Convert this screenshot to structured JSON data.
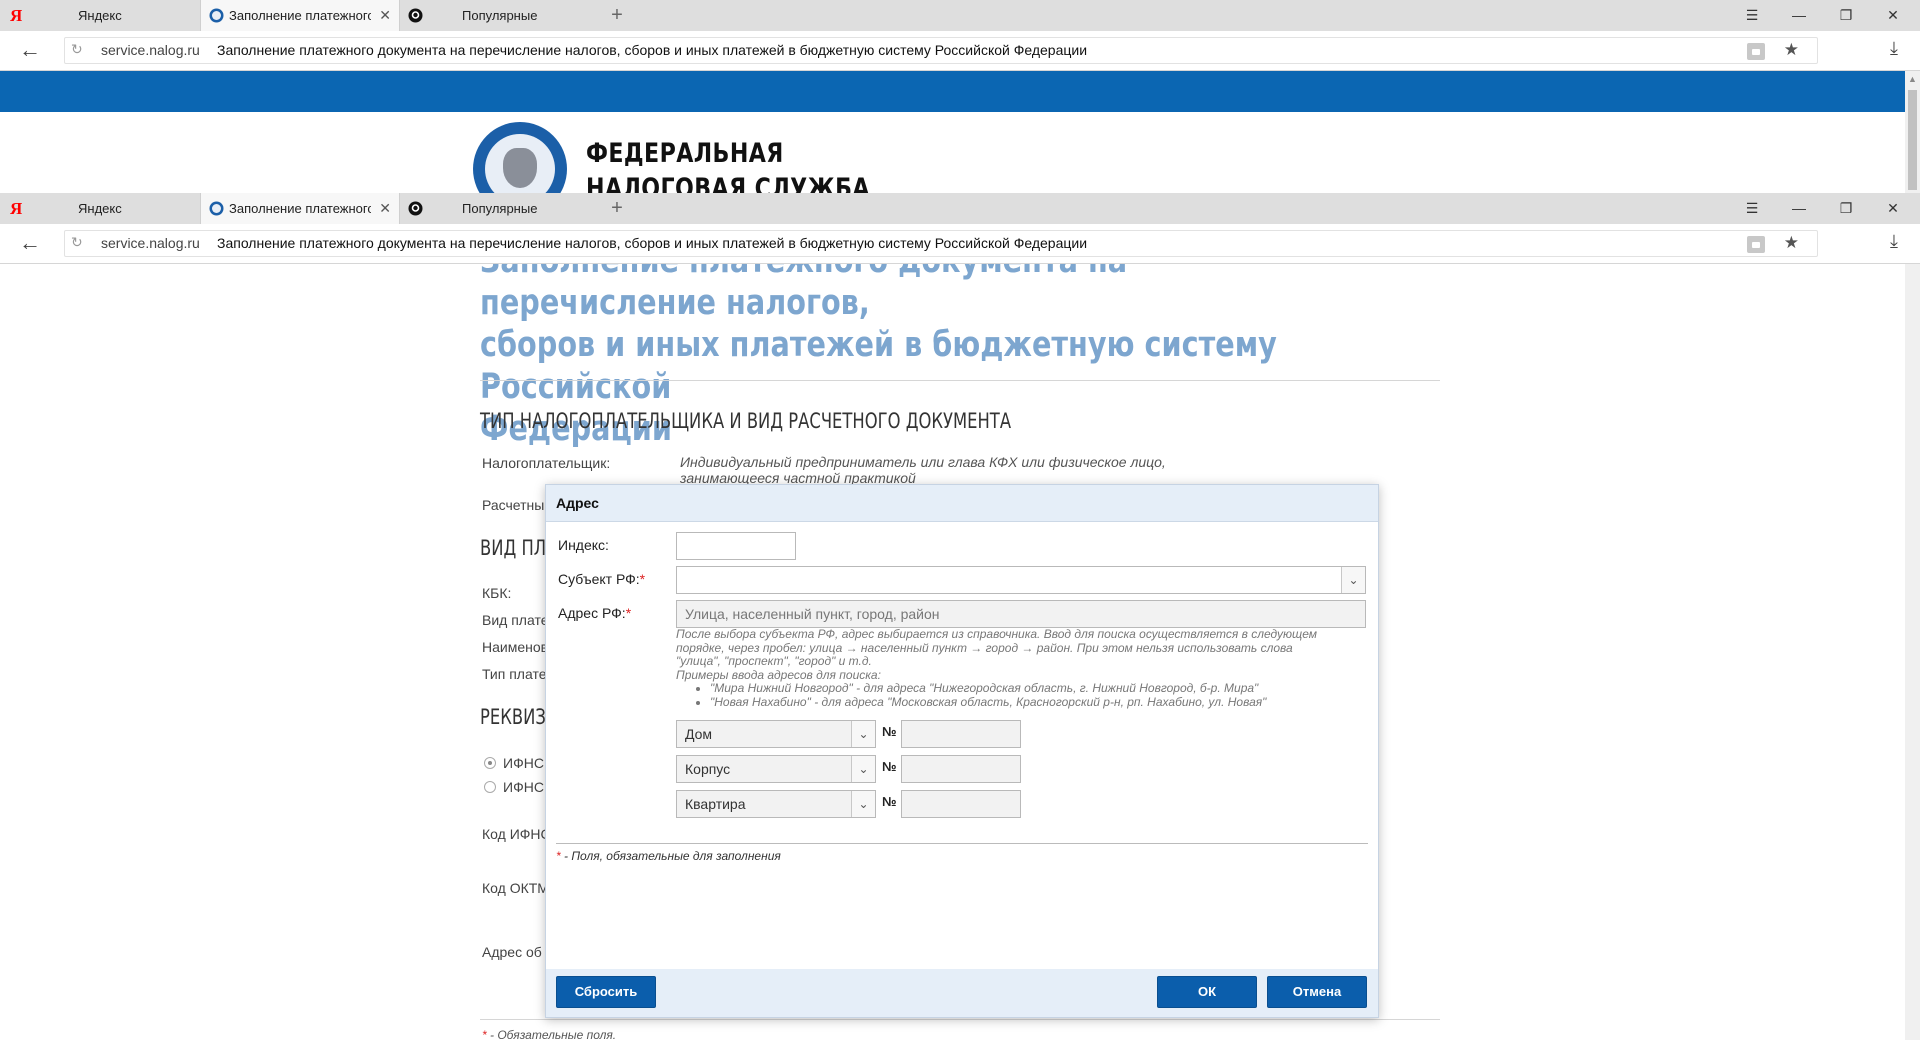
{
  "browser": {
    "tabs": [
      {
        "label": "Яндекс"
      },
      {
        "label": "Заполнение платежного"
      },
      {
        "label": "Популярные"
      }
    ],
    "window_buttons": {
      "menu": "☰",
      "minimize": "—",
      "restore": "❐",
      "close": "✕"
    },
    "newtab_symbol": "+",
    "tab_close_symbol": "✕",
    "yandex_logo": "Я",
    "back_symbol": "←",
    "reload_symbol": "↻",
    "star_symbol": "★",
    "download_symbol": "⤓",
    "domain": "service.nalog.ru",
    "page_title": "Заполнение платежного документа на перечисление налогов, сборов и иных платежей в бюджетную систему Российской Федерации"
  },
  "site": {
    "org_name_line1": "ФЕДЕРАЛЬНАЯ",
    "org_name_line2": "НАЛОГОВАЯ СЛУЖБА",
    "brand_color": "#0b66b2"
  },
  "page": {
    "title_line1": "Заполнение платежного документа на перечисление налогов,",
    "title_line2": "сборов и иных платежей в бюджетную систему Российской",
    "title_line3": "Федерации",
    "section1_title": "ТИП НАЛОГОПЛАТЕЛЬЩИКА И ВИД РАСЧЕТНОГО ДОКУМЕНТА",
    "taxpayer_label": "Налогоплательщик:",
    "taxpayer_value_line1": "Индивидуальный предприниматель или глава КФХ или физическое лицо,",
    "taxpayer_value_line2": "занимающееся частной практикой",
    "doc_label": "Расчетны",
    "section2_title": "ВИД ПЛА",
    "kbk_label": "КБК:",
    "type_label": "Вид плате",
    "name_label": "Наименов",
    "payer_type_label": "Тип плате",
    "section3_title": "РЕКВИЗ",
    "ifns_option1": "ИФНС",
    "ifns_option2": "ИФНС",
    "ifns_code_label": "Код ИФНС",
    "oktmo_label": "Код ОКТМ",
    "address_label": "Адрес об",
    "required_note": "- Обязательные поля.",
    "required_star": "*"
  },
  "dialog": {
    "title": "Адрес",
    "index_label": "Индекс:",
    "index_value": "",
    "subject_label": "Субъект РФ:",
    "subject_value": "",
    "address_label": "Адрес РФ:",
    "address_placeholder": "Улица, населенный пункт, город, район",
    "required_star": "*",
    "hint_line1": "После выбора субъекта РФ, адрес выбирается из справочника. Ввод для поиска осуществляется в следующем",
    "hint_line2": "порядке, через пробел: улица → населенный пункт → город → район. При этом нельзя использовать слова",
    "hint_line3": "\"улица\", \"проспект\", \"город\" и т.д.",
    "hint_line4": "Примеры ввода адресов для поиска:",
    "hint_examples": [
      "\"Мира Нижний Новгород\" - для адреса \"Нижегородская область, г. Нижний Новгород, б-р. Мира\"",
      "\"Новая Нахабино\" - для адреса \"Московская область, Красногорский р-н, рп. Нахабино, ул. Новая\""
    ],
    "house_type": "Дом",
    "building_type": "Корпус",
    "flat_type": "Квартира",
    "number_sign": "№",
    "dropdown_symbol": "⌄",
    "required_note": "- Поля, обязательные для заполнения",
    "reset_button": "Сбросить",
    "ok_button": "ОК",
    "cancel_button": "Отмена"
  }
}
